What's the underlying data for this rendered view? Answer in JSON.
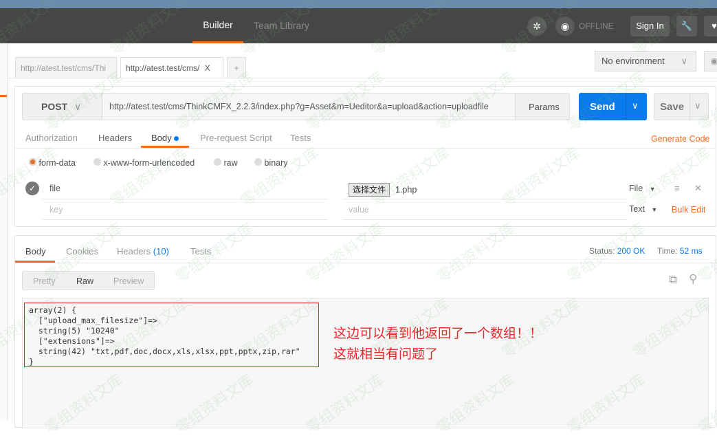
{
  "header": {
    "tabs": [
      {
        "label": "Builder",
        "active": true
      },
      {
        "label": "Team Library",
        "active": false
      }
    ],
    "offline": "OFFLINE",
    "sign_in": "Sign In"
  },
  "tabs": [
    {
      "label": "http://atest.test/cms/Thi"
    },
    {
      "label": "http://atest.test/cms/",
      "close": "X"
    }
  ],
  "add_tab": "+",
  "environment": {
    "selected": "No environment"
  },
  "request": {
    "method": "POST",
    "url": "http://atest.test/cms/ThinkCMFX_2.2.3/index.php?g=Asset&m=Ueditor&a=upload&action=uploadfile",
    "params": "Params",
    "send": "Send",
    "save": "Save"
  },
  "request_tabs": [
    {
      "label": "Authorization"
    },
    {
      "label": "Headers"
    },
    {
      "label": "Body",
      "active": true
    },
    {
      "label": "Pre-request Script"
    },
    {
      "label": "Tests"
    }
  ],
  "generate_code": "Generate Code",
  "body_modes": [
    {
      "label": "form-data",
      "selected": true
    },
    {
      "label": "x-www-form-urlencoded"
    },
    {
      "label": "raw"
    },
    {
      "label": "binary"
    }
  ],
  "form_rows": [
    {
      "key": "file",
      "choose_file": "选择文件",
      "value": "1.php",
      "type": "File",
      "checked": true
    },
    {
      "key_placeholder": "key",
      "value_placeholder": "value",
      "type": "Text"
    }
  ],
  "bulk_edit": "Bulk Edit",
  "response": {
    "tabs": [
      {
        "label": "Body",
        "active": true
      },
      {
        "label": "Cookies"
      },
      {
        "label": "Headers",
        "count": "(10)"
      },
      {
        "label": "Tests"
      }
    ],
    "status_label": "Status:",
    "status": "200 OK",
    "time_label": "Time:",
    "time": "52 ms",
    "views": [
      {
        "label": "Pretty"
      },
      {
        "label": "Raw",
        "active": true
      },
      {
        "label": "Preview"
      }
    ],
    "body": "array(2) {\n  [\"upload_max_filesize\"]=>\n  string(5) \"10240\"\n  [\"extensions\"]=>\n  string(42) \"txt,pdf,doc,docx,xls,xlsx,ppt,pptx,zip,rar\"\n}"
  },
  "annotation": {
    "line1": "这边可以看到他返回了一个数组！！",
    "line2": "这就相当有问题了",
    "color": "#e8262a"
  },
  "colors": {
    "accent": "#f26b21",
    "send": "#097bed",
    "link": "#097bed"
  },
  "watermark": "零组资料文库"
}
